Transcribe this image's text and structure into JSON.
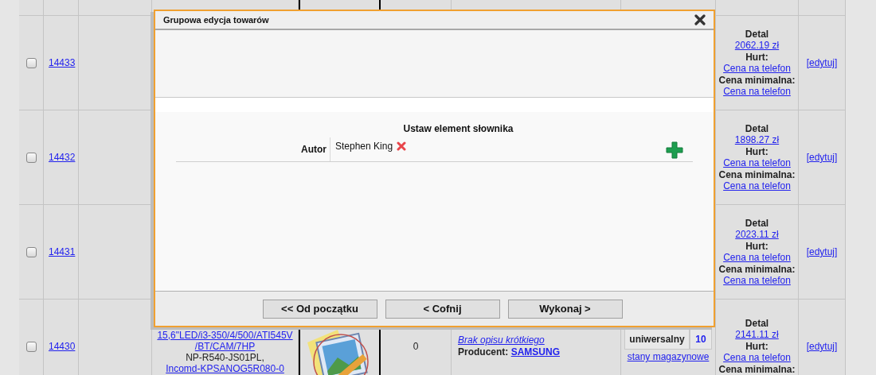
{
  "dialog": {
    "title": "Grupowa edycja towarów",
    "section_title": "Ustaw element słownika",
    "field": {
      "label": "Autor",
      "values": [
        "Stephen King"
      ]
    },
    "buttons": [
      "<< Od początku",
      "< Cofnij",
      "Wykonaj >"
    ]
  },
  "rows": [
    {
      "id": "14433",
      "checked": false,
      "price": {
        "retail_label": "Detal",
        "retail": "2062.19 zł",
        "wholesale_label": "Hurt:",
        "wholesale": "Cena na telefon",
        "min_label": "Cena minimalna:",
        "min": "Cena na telefon"
      },
      "edit": "[edytuj]"
    },
    {
      "id": "14432",
      "checked": false,
      "price": {
        "retail_label": "Detal",
        "retail": "1898.27 zł",
        "wholesale_label": "Hurt:",
        "wholesale": "Cena na telefon",
        "min_label": "Cena minimalna:",
        "min": "Cena na telefon"
      },
      "edit": "[edytuj]"
    },
    {
      "id": "14431",
      "checked": false,
      "price": {
        "retail_label": "Detal",
        "retail": "2023.11 zł",
        "wholesale_label": "Hurt:",
        "wholesale": "Cena na telefon",
        "min_label": "Cena minimalna:",
        "min": "Cena na telefon"
      },
      "edit": "[edytuj]"
    },
    {
      "id": "14430",
      "checked": false,
      "product_lines": [
        {
          "kind": "link",
          "text": "15,6\"LED/i3-350/4/500/ATI545V"
        },
        {
          "kind": "link",
          "text": "/BT/CAM/7HP"
        },
        {
          "kind": "text",
          "text": "NP-R540-JS01PL,"
        },
        {
          "kind": "link",
          "text": "Incomd-KPSANOG5R080-0"
        }
      ],
      "quantity": "0",
      "description": "Brak opisu krótkiego",
      "producer_label": "Producent:",
      "producer": "SAMSUNG",
      "stock": [
        {
          "name": "uniwersalny",
          "count": "10"
        }
      ],
      "stock_link": "stany magazynowe",
      "price": {
        "retail_label": "Detal",
        "retail": "2141.11 zł",
        "wholesale_label": "Hurt:",
        "wholesale": "Cena na telefon",
        "min_label": "Cena minimalna:"
      },
      "edit": "[edytuj]"
    }
  ]
}
